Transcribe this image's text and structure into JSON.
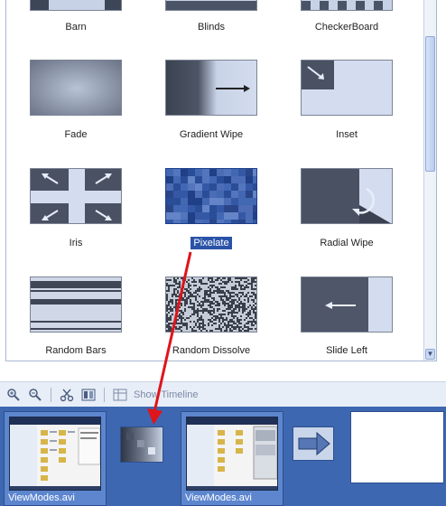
{
  "gallery": {
    "top_row": [
      "Barn",
      "Blinds",
      "CheckerBoard"
    ],
    "rows": [
      [
        "Fade",
        "Gradient Wipe",
        "Inset"
      ],
      [
        "Iris",
        "Pixelate",
        "Radial Wipe"
      ],
      [
        "Random Bars",
        "Random Dissolve",
        "Slide Left"
      ]
    ],
    "selected": "Pixelate"
  },
  "toolbar": {
    "show_timeline_label": "Show Timeline"
  },
  "storyboard": {
    "clips": [
      "ViewModes.avi",
      "ViewModes.avi"
    ]
  },
  "colors": {
    "storyboard_bg": "#3e67b1",
    "selection": "#2a53a8",
    "annotation_arrow": "#e0141b"
  }
}
